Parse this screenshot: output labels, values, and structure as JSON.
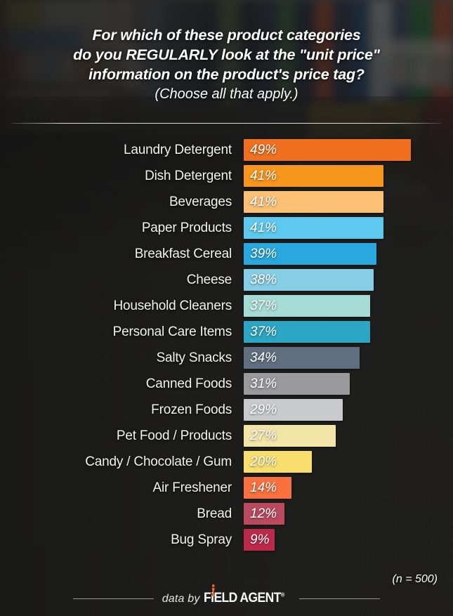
{
  "title": {
    "line1": "For which of these product categories",
    "line2": "do you REGULARLY look at the \"unit price\"",
    "line3": "information on the product's  price tag?",
    "line4": "(Choose all that apply.)"
  },
  "sample_size": "(n = 500)",
  "footer": {
    "data_by": "data by",
    "brand_part1": "F",
    "brand_i": "i",
    "brand_part2": "ELD AGENT",
    "registered": "®",
    "brand_accent_color": "#f26722"
  },
  "chart_data": {
    "type": "bar",
    "orientation": "horizontal",
    "title": "For which of these product categories do you REGULARLY look at the \"unit price\" information on the product's  price tag?",
    "subtitle": "(Choose all that apply.)",
    "xlabel": "",
    "ylabel": "",
    "xlim": [
      0,
      49
    ],
    "grid": false,
    "legend": false,
    "value_suffix": "%",
    "sample_size": 500,
    "categories": [
      "Laundry Detergent",
      "Dish Detergent",
      "Beverages",
      "Paper Products",
      "Breakfast Cereal",
      "Cheese",
      "Household Cleaners",
      "Personal Care Items",
      "Salty Snacks",
      "Canned Foods",
      "Frozen Foods",
      "Pet Food / Products",
      "Candy / Chocolate / Gum",
      "Air Freshener",
      "Bread",
      "Bug Spray"
    ],
    "values": [
      49,
      41,
      41,
      41,
      39,
      38,
      37,
      37,
      34,
      31,
      29,
      27,
      20,
      14,
      12,
      9
    ],
    "labels": [
      "49%",
      "41%",
      "41%",
      "41%",
      "39%",
      "38%",
      "37%",
      "37%",
      "34%",
      "31%",
      "29%",
      "27%",
      "20%",
      "14%",
      "12%",
      "9%"
    ],
    "colors": [
      "#f0701f",
      "#f7951d",
      "#fbc074",
      "#5ec9ef",
      "#28a8de",
      "#86cee6",
      "#a5dcd5",
      "#2ba6c4",
      "#5f6f7f",
      "#9a9a9d",
      "#c8cace",
      "#f3e5a8",
      "#f8df6d",
      "#f9713f",
      "#bc4a5e",
      "#bd2a49"
    ]
  }
}
